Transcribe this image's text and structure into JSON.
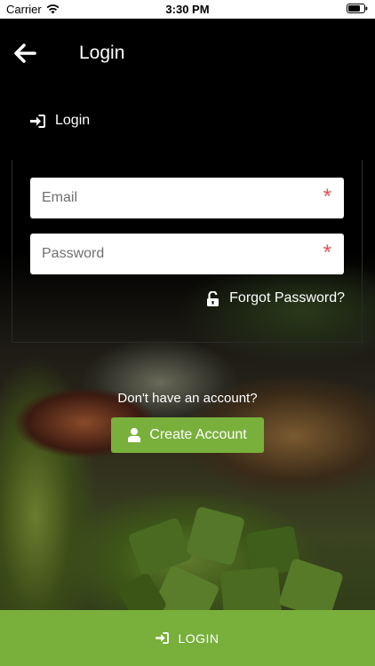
{
  "status_bar": {
    "carrier": "Carrier",
    "time": "3:30 PM",
    "icons": [
      "wifi-icon",
      "battery-icon"
    ]
  },
  "header": {
    "title": "Login",
    "back_icon": "arrow-left-icon"
  },
  "section": {
    "label": "Login",
    "icon": "sign-in-icon"
  },
  "form": {
    "email": {
      "placeholder": "Email",
      "value": "",
      "required_mark": "*"
    },
    "password": {
      "placeholder": "Password",
      "value": "",
      "required_mark": "*"
    },
    "forgot_password": {
      "label": "Forgot Password?",
      "icon": "unlock-icon"
    }
  },
  "signup": {
    "prompt": "Don't have an account?",
    "button_label": "Create Account",
    "button_icon": "user-icon"
  },
  "bottom_bar": {
    "label": "LOGIN",
    "icon": "sign-in-icon"
  },
  "colors": {
    "accent": "#79b03c",
    "required": "#e05252",
    "header_bg": "#000000",
    "text": "#ffffff"
  }
}
